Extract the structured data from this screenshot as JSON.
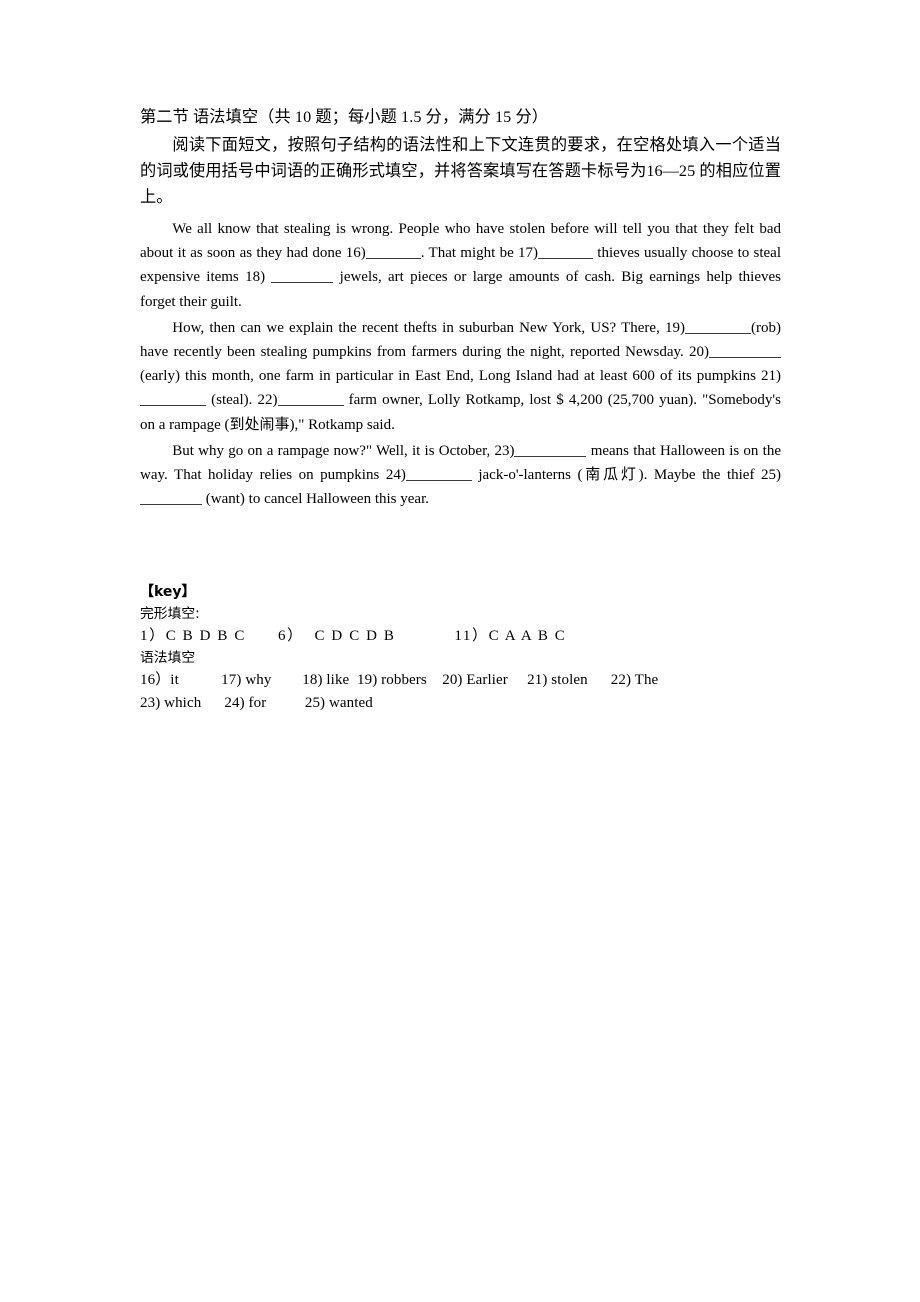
{
  "document": {
    "section_heading": "第二节  语法填空（共 10 题；每小题 1.5 分，满分 15 分）",
    "instructions": "阅读下面短文，按照句子结构的语法性和上下文连贯的要求，在空格处填入一个适当的词或使用括号中词语的正确形式填空，并将答案填写在答题卡标号为16—25 的相应位置上。",
    "paragraph1": {
      "seg1": "We all know that stealing is wrong. People who have stolen before will tell you that they felt bad about it as soon as they had done 16)",
      "seg2": ". That might be 17)",
      "seg3": " thieves usually choose to steal expensive items 18) ",
      "seg4": " jewels, art pieces or large amounts of cash. Big earnings help thieves forget their guilt."
    },
    "paragraph2": {
      "seg1": "How, then can we explain the recent thefts in suburban New York, US? There, 19)",
      "seg2": "(rob) have recently been stealing pumpkins from farmers during the night, reported Newsday. 20)",
      "seg3": " (early) this month, one farm in particular in East End, Long Island had at least 600 of its pumpkins 21)",
      "seg4": " (steal). 22)",
      "seg5": " farm owner, Lolly Rotkamp, lost $ 4,200 (25,700 yuan). \"Somebody's on a rampage (到处闹事),\" Rotkamp said."
    },
    "paragraph3": {
      "seg1": "But why go on a rampage now?\" Well, it is October, 23)",
      "seg2": " means that Halloween is on the way. That holiday relies on pumpkins 24)",
      "seg3": " jack-o'-lanterns (南瓜灯). Maybe the thief 25)",
      "seg4": " (want) to cancel Halloween this year."
    },
    "answer_key": {
      "title": "【key】",
      "cloze_label": "完形填空:",
      "cloze_answers": "1）C B D B C      6）  C D C D B           11）C A A B C",
      "grammar_label": "语法填空",
      "grammar_row1": "16）it           17) why        18) like  19) robbers    20) Earlier     21) stolen      22) The",
      "grammar_row2": "23) which      24) for          25) wanted"
    }
  }
}
